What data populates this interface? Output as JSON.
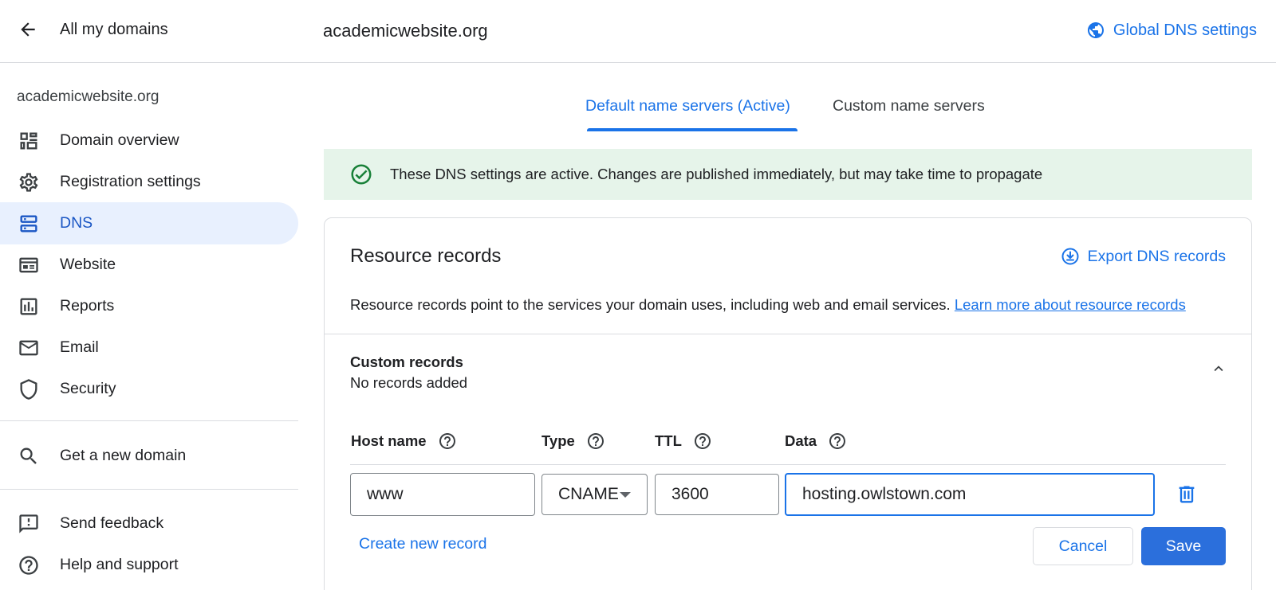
{
  "header": {
    "back_label": "All my domains",
    "domain_title": "academicwebsite.org",
    "global_dns_label": "Global DNS settings"
  },
  "sidebar": {
    "domain": "academicwebsite.org",
    "items": [
      {
        "label": "Domain overview",
        "icon": "dashboard-icon"
      },
      {
        "label": "Registration settings",
        "icon": "gear-icon"
      },
      {
        "label": "DNS",
        "icon": "dns-icon",
        "active": true
      },
      {
        "label": "Website",
        "icon": "website-icon"
      },
      {
        "label": "Reports",
        "icon": "reports-icon"
      },
      {
        "label": "Email",
        "icon": "mail-icon"
      },
      {
        "label": "Security",
        "icon": "shield-icon"
      }
    ],
    "get_domain_label": "Get a new domain",
    "feedback_label": "Send feedback",
    "help_label": "Help and support"
  },
  "tabs": [
    {
      "label": "Default name servers (Active)",
      "active": true
    },
    {
      "label": "Custom name servers",
      "active": false
    }
  ],
  "banner": {
    "text": "These DNS settings are active. Changes are published immediately, but may take time to propagate"
  },
  "resource_records": {
    "title": "Resource records",
    "export_label": "Export DNS records",
    "description": "Resource records point to the services your domain uses, including web and email services.",
    "learn_more_label": "Learn more about resource records"
  },
  "custom_records": {
    "title": "Custom records",
    "subtitle": "No records added",
    "columns": [
      "Host name",
      "Type",
      "TTL",
      "Data"
    ],
    "new_record": {
      "host_name": "www",
      "type": "CNAME",
      "ttl": "3600",
      "data": "hosting.owlstown.com"
    },
    "create_label": "Create new record",
    "cancel_label": "Cancel",
    "save_label": "Save"
  },
  "colors": {
    "accent": "#1a73e8",
    "active_nav_bg": "#e8f0fe",
    "banner_bg": "#e6f4ea",
    "success": "#188038"
  }
}
